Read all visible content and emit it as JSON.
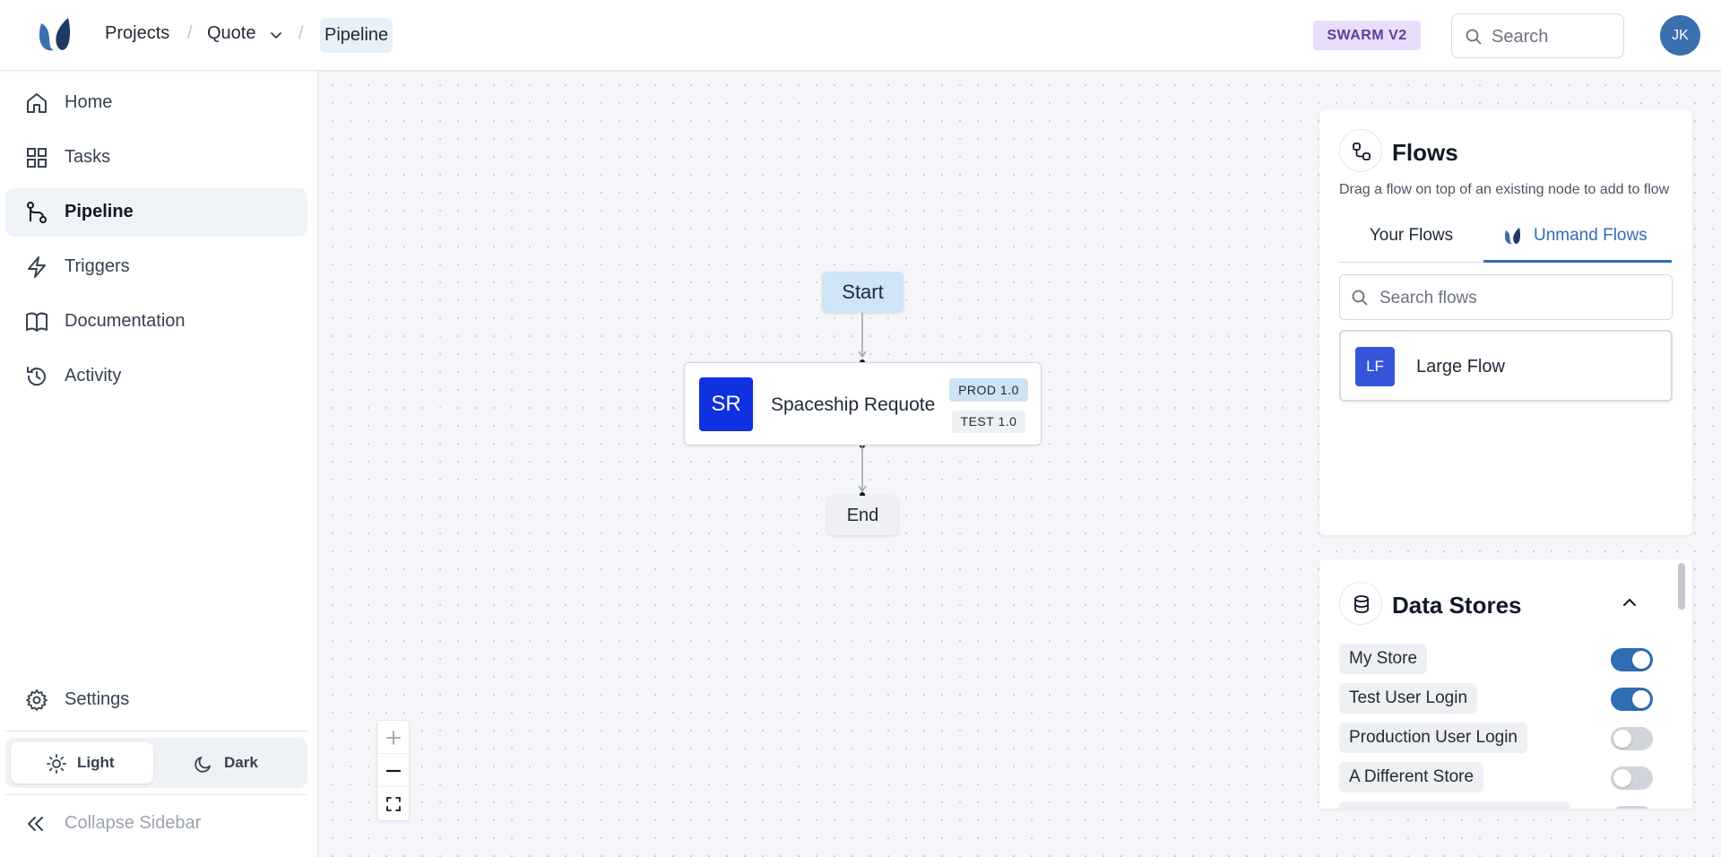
{
  "header": {
    "breadcrumbs": [
      "Projects",
      "Quote",
      "Pipeline"
    ],
    "badge": "SWARM V2",
    "search_placeholder": "Search",
    "avatar_initials": "JK"
  },
  "sidebar": {
    "items": [
      {
        "label": "Home",
        "icon": "home-icon"
      },
      {
        "label": "Tasks",
        "icon": "grid-icon"
      },
      {
        "label": "Pipeline",
        "icon": "pipeline-icon",
        "active": true
      },
      {
        "label": "Triggers",
        "icon": "lightning-icon"
      },
      {
        "label": "Documentation",
        "icon": "book-icon"
      },
      {
        "label": "Activity",
        "icon": "history-icon"
      }
    ],
    "settings_label": "Settings",
    "theme": {
      "light_label": "Light",
      "dark_label": "Dark",
      "selected": "Light"
    },
    "collapse_label": "Collapse Sidebar"
  },
  "canvas": {
    "start_label": "Start",
    "end_label": "End",
    "node": {
      "initials": "SR",
      "title": "Spaceship Requote",
      "tags": [
        "PROD 1.0",
        "TEST 1.0"
      ]
    },
    "zoom_controls": [
      "zoom-in",
      "zoom-out",
      "fit-view"
    ]
  },
  "flows_panel": {
    "title": "Flows",
    "description": "Drag a flow on top of an existing node to add to flow",
    "tabs": [
      "Your Flows",
      "Unmand Flows"
    ],
    "active_tab": "Unmand Flows",
    "search_placeholder": "Search flows",
    "items": [
      {
        "initials": "LF",
        "label": "Large Flow"
      }
    ]
  },
  "data_stores": {
    "title": "Data Stores",
    "items": [
      {
        "label": "My Store",
        "enabled": true
      },
      {
        "label": "Test User Login",
        "enabled": true
      },
      {
        "label": "Production User Login",
        "enabled": false
      },
      {
        "label": "A Different Store",
        "enabled": false
      }
    ]
  },
  "colors": {
    "accent": "#2f6db5",
    "badge_bg": "#e9ddfb",
    "node_avatar": "#1031e0",
    "flow_avatar": "#3556d8"
  }
}
